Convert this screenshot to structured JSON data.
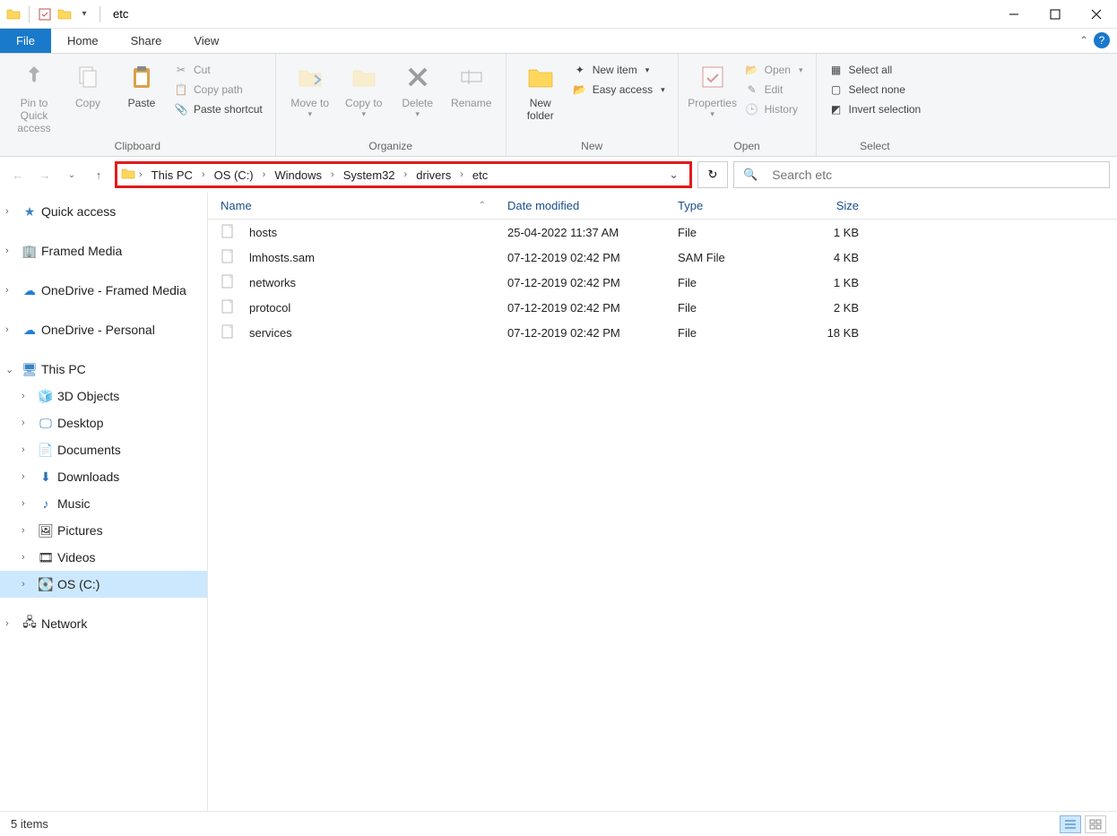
{
  "title": "etc",
  "tabs": {
    "file": "File",
    "home": "Home",
    "share": "Share",
    "view": "View"
  },
  "ribbon": {
    "clipboard": {
      "label": "Clipboard",
      "pin": "Pin to Quick access",
      "copy": "Copy",
      "paste": "Paste",
      "cut": "Cut",
      "copypath": "Copy path",
      "pasteshort": "Paste shortcut"
    },
    "organize": {
      "label": "Organize",
      "moveto": "Move to",
      "copyto": "Copy to",
      "delete": "Delete",
      "rename": "Rename"
    },
    "new": {
      "label": "New",
      "newfolder": "New folder",
      "newitem": "New item",
      "easyaccess": "Easy access"
    },
    "open": {
      "label": "Open",
      "properties": "Properties",
      "open": "Open",
      "edit": "Edit",
      "history": "History"
    },
    "select": {
      "label": "Select",
      "all": "Select all",
      "none": "Select none",
      "invert": "Invert selection"
    }
  },
  "breadcrumbs": [
    "This PC",
    "OS (C:)",
    "Windows",
    "System32",
    "drivers",
    "etc"
  ],
  "search_placeholder": "Search etc",
  "columns": {
    "name": "Name",
    "date": "Date modified",
    "type": "Type",
    "size": "Size"
  },
  "tree": {
    "quick": "Quick access",
    "framed": "Framed Media",
    "od1": "OneDrive - Framed Media",
    "od2": "OneDrive - Personal",
    "thispc": "This PC",
    "children": [
      "3D Objects",
      "Desktop",
      "Documents",
      "Downloads",
      "Music",
      "Pictures",
      "Videos",
      "OS (C:)"
    ],
    "network": "Network"
  },
  "files": [
    {
      "name": "hosts",
      "date": "25-04-2022 11:37 AM",
      "type": "File",
      "size": "1 KB"
    },
    {
      "name": "lmhosts.sam",
      "date": "07-12-2019 02:42 PM",
      "type": "SAM File",
      "size": "4 KB"
    },
    {
      "name": "networks",
      "date": "07-12-2019 02:42 PM",
      "type": "File",
      "size": "1 KB"
    },
    {
      "name": "protocol",
      "date": "07-12-2019 02:42 PM",
      "type": "File",
      "size": "2 KB"
    },
    {
      "name": "services",
      "date": "07-12-2019 02:42 PM",
      "type": "File",
      "size": "18 KB"
    }
  ],
  "status": "5 items"
}
